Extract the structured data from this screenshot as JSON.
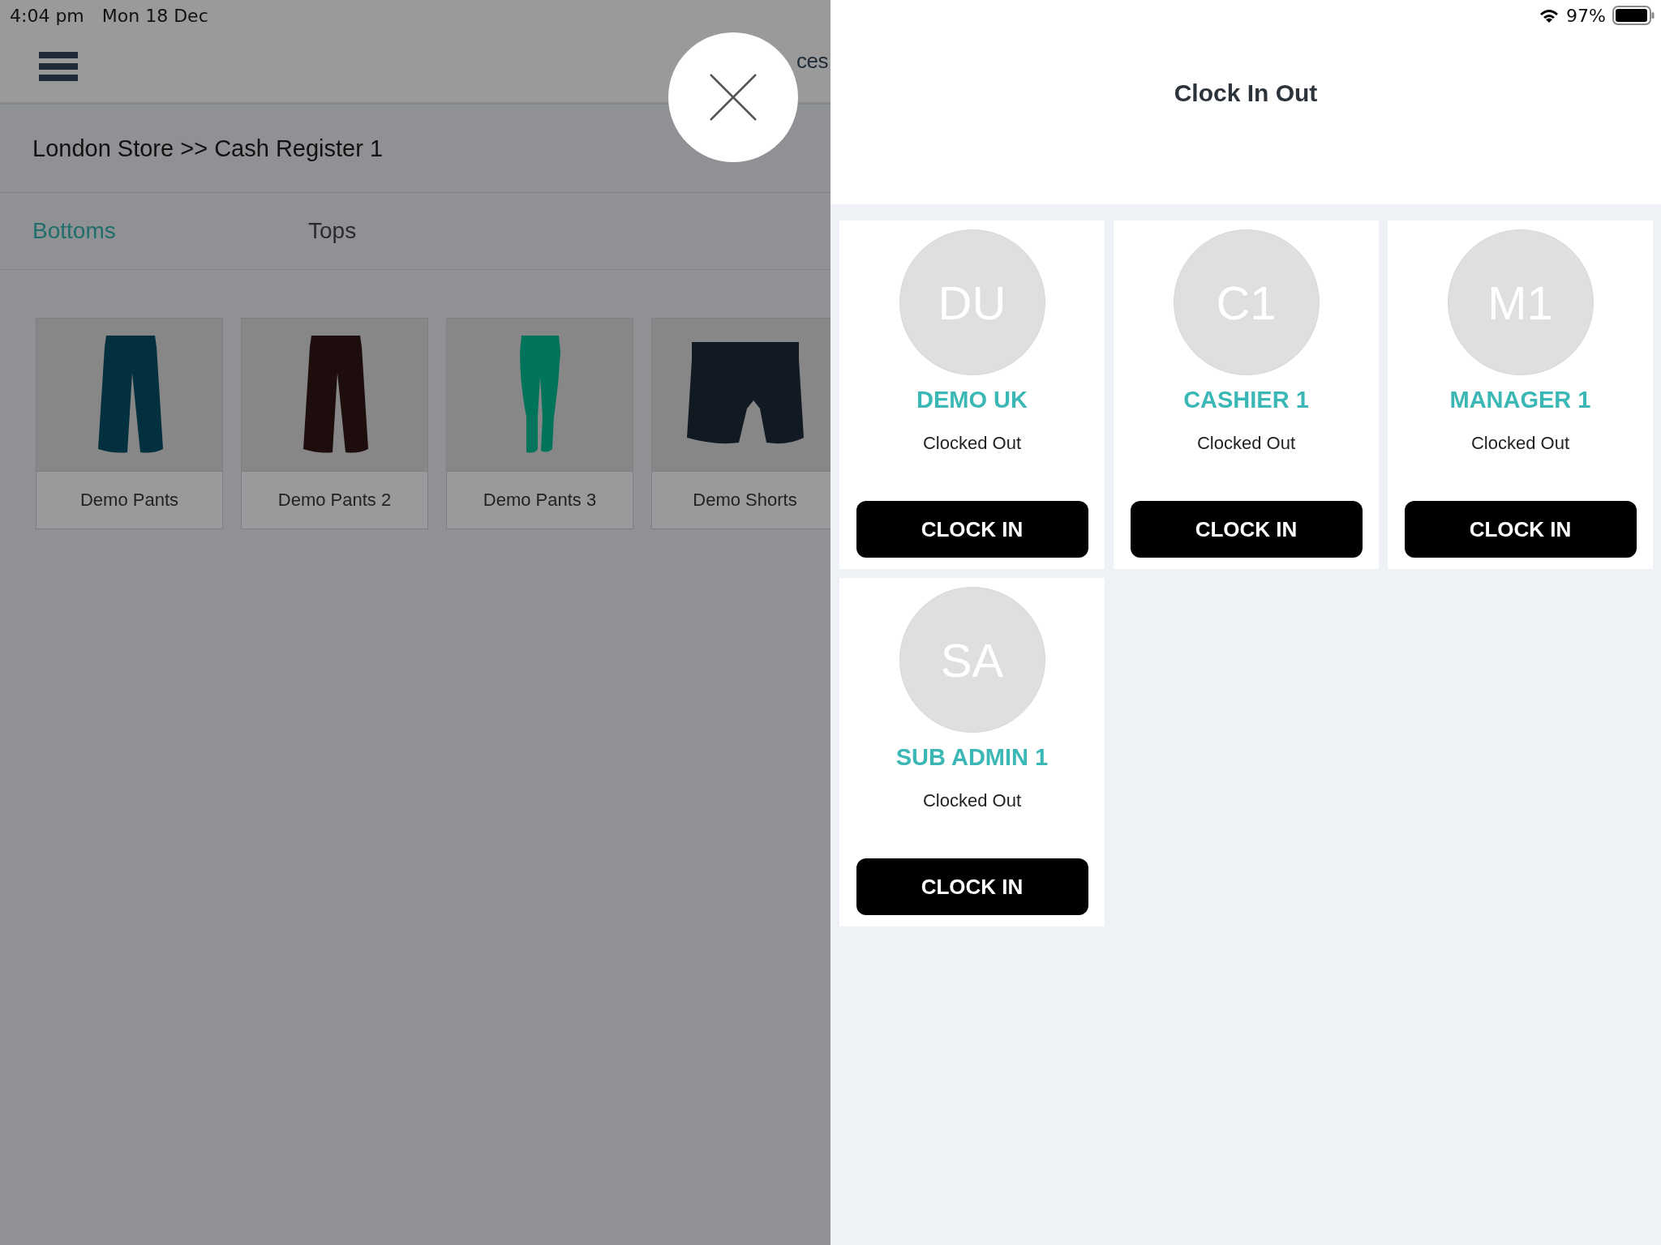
{
  "status_bar": {
    "time": "4:04 pm",
    "date": "Mon 18 Dec",
    "battery": "97%"
  },
  "background_screen": {
    "header_title": "ces",
    "breadcrumb": "London Store >> Cash Register 1",
    "tabs": [
      {
        "label": "Bottoms",
        "selected": true
      },
      {
        "label": "Tops",
        "selected": false
      }
    ],
    "products": [
      {
        "name": "Demo Pants",
        "kind": "pants",
        "color": "#02303f"
      },
      {
        "name": "Demo Pants 2",
        "kind": "pants",
        "color": "#1d0d0d"
      },
      {
        "name": "Demo Pants 3",
        "kind": "jeans",
        "color": "#00745a"
      },
      {
        "name": "Demo Shorts",
        "kind": "shorts",
        "color": "#111922"
      }
    ]
  },
  "clock_panel": {
    "title": "Clock In Out",
    "staff": [
      {
        "initials": "DU",
        "name": "DEMO UK",
        "status": "Clocked Out",
        "button": "CLOCK IN"
      },
      {
        "initials": "C1",
        "name": "CASHIER 1",
        "status": "Clocked Out",
        "button": "CLOCK IN"
      },
      {
        "initials": "M1",
        "name": "MANAGER 1",
        "status": "Clocked Out",
        "button": "CLOCK IN"
      },
      {
        "initials": "SA",
        "name": "SUB ADMIN 1",
        "status": "Clocked Out",
        "button": "CLOCK IN"
      }
    ]
  }
}
